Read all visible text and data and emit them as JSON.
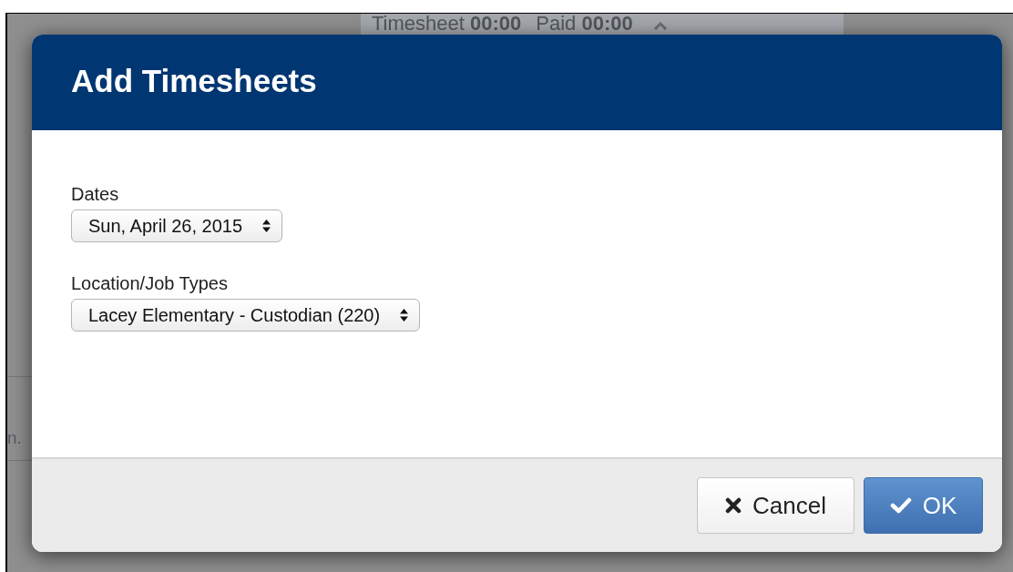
{
  "background": {
    "summary": [
      {
        "label": "Timesheet",
        "value": "00:00"
      },
      {
        "label": "Paid",
        "value": "00:00"
      }
    ],
    "side_text": "n."
  },
  "dialog": {
    "title": "Add Timesheets",
    "fields": [
      {
        "label": "Dates",
        "value": "Sun, April 26, 2015"
      },
      {
        "label": "Location/Job Types",
        "value": "Lacey Elementary - Custodian (220)"
      }
    ],
    "buttons": [
      {
        "kind": "cancel",
        "label": "Cancel"
      },
      {
        "kind": "ok",
        "label": "OK"
      }
    ]
  }
}
